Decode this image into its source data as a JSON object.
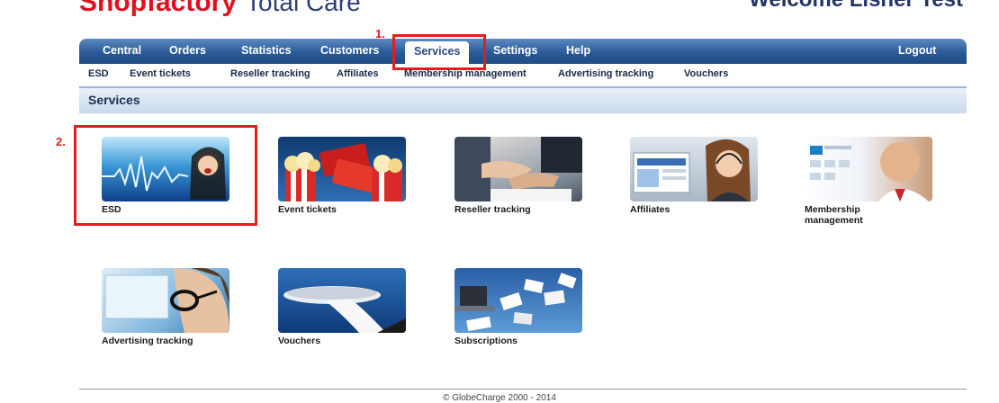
{
  "header": {
    "brand_part1": "Shopfactory",
    "brand_part2": "Total Care",
    "welcome": "Welcome Lisher Test"
  },
  "nav": {
    "tabs": [
      "Central",
      "Orders",
      "Statistics",
      "Customers",
      "Services",
      "Settings",
      "Help"
    ],
    "active_tab": "Services",
    "logout": "Logout"
  },
  "subnav": [
    "ESD",
    "Event tickets",
    "Reseller tracking",
    "Affiliates",
    "Membership management",
    "Advertising tracking",
    "Vouchers"
  ],
  "section": {
    "title": "Services"
  },
  "annotations": {
    "step1": "1.",
    "step2": "2."
  },
  "services": [
    {
      "label": "ESD",
      "icon": "esd-waveform-woman-image"
    },
    {
      "label": "Event tickets",
      "icon": "popcorn-tickets-image"
    },
    {
      "label": "Reseller tracking",
      "icon": "handshake-image"
    },
    {
      "label": "Affiliates",
      "icon": "support-agent-image"
    },
    {
      "label": "Membership management",
      "icon": "membership-man-image"
    },
    {
      "label": "Advertising tracking",
      "icon": "glasses-screen-image"
    },
    {
      "label": "Vouchers",
      "icon": "serving-tray-image"
    },
    {
      "label": "Subscriptions",
      "icon": "flying-papers-laptop-image"
    }
  ],
  "footer": {
    "copyright": "© GlobeCharge 2000 - 2014"
  },
  "colors": {
    "nav_blue": "#2a5a98",
    "annotation_red": "#e41c1c",
    "brand_red": "#e0101e"
  }
}
